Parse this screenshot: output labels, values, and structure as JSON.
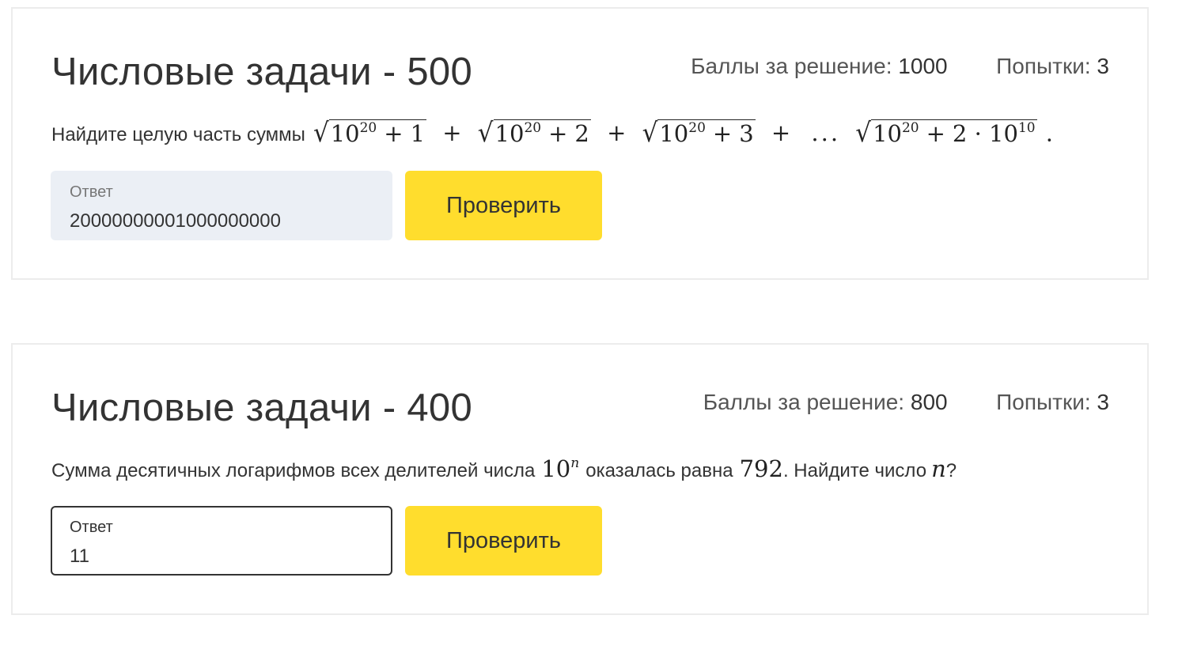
{
  "tasks": [
    {
      "title": "Числовые задачи - 500",
      "points_label": "Баллы за решение:",
      "points_value": "1000",
      "attempts_label": "Попытки:",
      "attempts_value": "3",
      "question_text": "Найдите целую часть суммы",
      "math": {
        "base": "10",
        "exp": "20",
        "terms": [
          "1",
          "2",
          "3"
        ],
        "last_term": "2 · 10",
        "last_exp": "10",
        "plus": "+",
        "dots": "...",
        "end": "."
      },
      "answer_label": "Ответ",
      "answer_value": "20000000001000000000",
      "check_label": "Проверить"
    },
    {
      "title": "Числовые задачи - 400",
      "points_label": "Баллы за решение:",
      "points_value": "800",
      "attempts_label": "Попытки:",
      "attempts_value": "3",
      "question_part1": "Сумма десятичных логарифмов всех делителей числа",
      "math_base": "10",
      "math_exp": "n",
      "question_part2": "оказалась равна",
      "math_value": "792",
      "question_part3": ". Найдите число",
      "math_var": "n",
      "question_end": "?",
      "answer_label": "Ответ",
      "answer_value": "11",
      "check_label": "Проверить"
    }
  ]
}
